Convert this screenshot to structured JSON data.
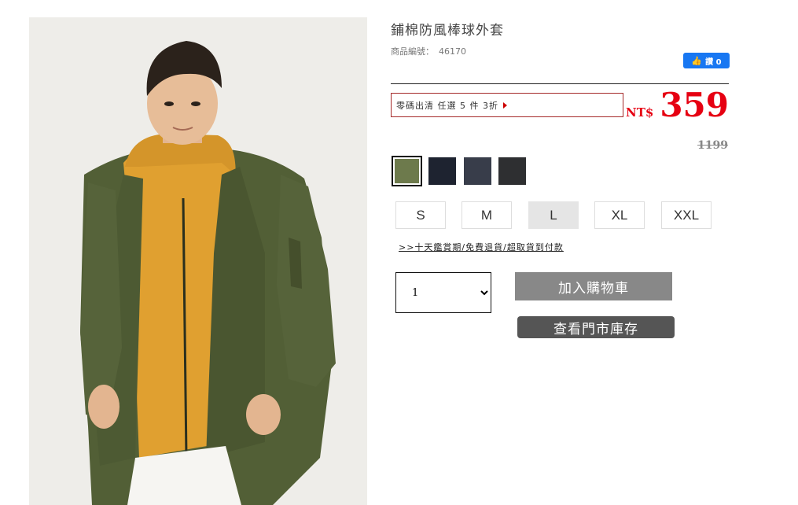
{
  "product": {
    "title": "鋪棉防風棒球外套",
    "sku_label": "商品編號：",
    "sku_value": "46170",
    "image_alt": "鋪棉防風棒球外套"
  },
  "like": {
    "icon": "thumbs-up-icon",
    "label": "讚 0"
  },
  "promo": {
    "text": "零碼出清 任選 5 件 3折"
  },
  "price": {
    "currency": "NT$",
    "amount": "359",
    "original": "1199",
    "color": "#e60012"
  },
  "colors": [
    {
      "hex": "#6d7a4c",
      "selected": true
    },
    {
      "hex": "#1e2330",
      "selected": false
    },
    {
      "hex": "#383d4a",
      "selected": false
    },
    {
      "hex": "#2e2f31",
      "selected": false
    }
  ],
  "sizes": [
    {
      "label": "S",
      "selected": false
    },
    {
      "label": "M",
      "selected": false
    },
    {
      "label": "L",
      "selected": true
    },
    {
      "label": "XL",
      "selected": false
    },
    {
      "label": "XXL",
      "selected": false
    }
  ],
  "info_link": ">>十天鑑賞期/免費退貨/超取貨到付款",
  "quantity": {
    "value": "1"
  },
  "buttons": {
    "add_to_cart": "加入購物車",
    "check_stock": "查看門市庫存"
  }
}
